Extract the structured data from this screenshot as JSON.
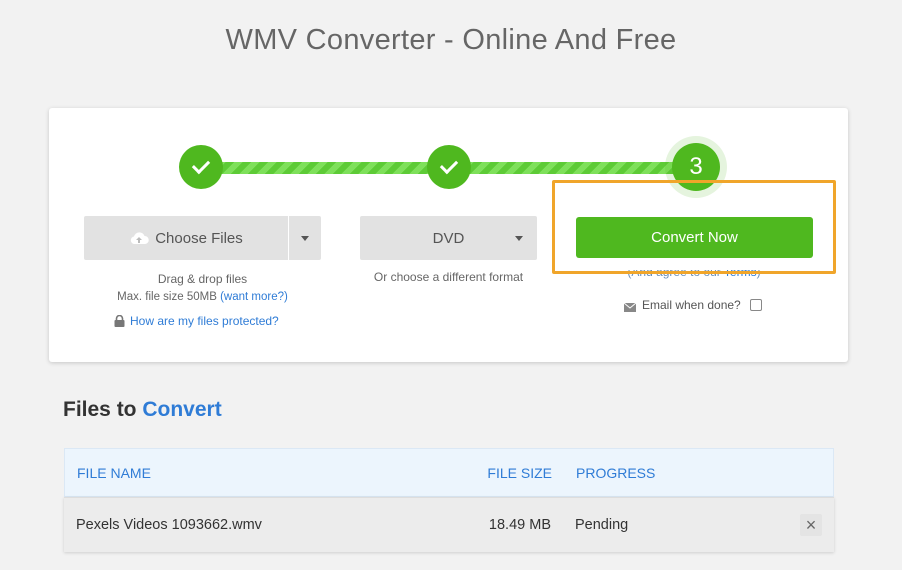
{
  "page": {
    "title": "WMV Converter - Online And Free"
  },
  "steps": {
    "step3": "3"
  },
  "upload": {
    "choose_label": "Choose Files",
    "drag_hint": "Drag & drop files",
    "max_size_prefix": "Max. file size 50MB ",
    "want_more": "(want more?)",
    "protected_link": "How are my files protected?"
  },
  "format": {
    "selected": "DVD",
    "hint": "Or choose a different format"
  },
  "convert": {
    "button_label": "Convert Now",
    "agree_prefix": "(And agree to our ",
    "terms_link": "Terms",
    "agree_suffix": ")",
    "email_label": "Email when done?"
  },
  "files": {
    "title_prefix": "Files to ",
    "title_accent": "Convert",
    "columns": {
      "name": "FILE NAME",
      "size": "FILE SIZE",
      "progress": "PROGRESS"
    },
    "rows": [
      {
        "name": "Pexels Videos 1093662.wmv",
        "size": "18.49 MB",
        "progress": "Pending",
        "remove": "×"
      }
    ]
  },
  "colors": {
    "accent_green": "#4fb81f",
    "link_blue": "#2f7cd6",
    "highlight": "#f0a52a"
  }
}
